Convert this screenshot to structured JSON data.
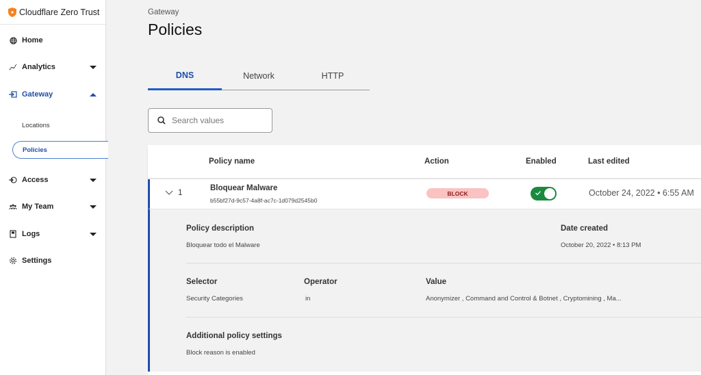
{
  "app": {
    "brand_name": "Cloudflare Zero Trust",
    "accent_color": "#1f4fa8",
    "logo_color": "#f6821f"
  },
  "sidebar": {
    "items": [
      {
        "label": "Home",
        "icon": "globe-icon"
      },
      {
        "label": "Analytics",
        "icon": "analytics-icon",
        "caret": "down"
      },
      {
        "label": "Gateway",
        "icon": "gateway-icon",
        "caret": "up",
        "active": true
      },
      {
        "label": "Access",
        "icon": "access-icon",
        "caret": "down"
      },
      {
        "label": "My Team",
        "icon": "team-icon",
        "caret": "down"
      },
      {
        "label": "Logs",
        "icon": "logs-icon",
        "caret": "down"
      },
      {
        "label": "Settings",
        "icon": "gear-icon"
      }
    ],
    "gateway_sub": [
      {
        "label": "Locations"
      },
      {
        "label": "Policies",
        "selected": true
      }
    ]
  },
  "header": {
    "breadcrumb": "Gateway",
    "title": "Policies"
  },
  "tabs": [
    {
      "label": "DNS",
      "active": true
    },
    {
      "label": "Network"
    },
    {
      "label": "HTTP"
    }
  ],
  "search": {
    "placeholder": "Search values",
    "value": ""
  },
  "table": {
    "columns": [
      "Policy name",
      "Action",
      "Enabled",
      "Last edited"
    ],
    "rows": [
      {
        "index": "1",
        "name": "Bloquear Malware",
        "id": "b55bf27d-9c57-4a8f-ac7c-1d079d2545b0",
        "action": "BLOCK",
        "enabled": true,
        "last_edited": "October 24, 2022 • 6:55 AM",
        "expanded": true,
        "details": {
          "description_label": "Policy description",
          "description": "Bloquear todo el Malware",
          "date_created_label": "Date created",
          "date_created": "October 20, 2022 • 8:13 PM",
          "selector_label": "Selector",
          "selector": "Security Categories",
          "operator_label": "Operator",
          "operator": "in",
          "value_label": "Value",
          "value": "Anonymizer , Command and Control & Botnet , Cryptomining , Ma...",
          "additional_label": "Additional policy settings",
          "additional": "Block reason is enabled"
        }
      }
    ]
  }
}
